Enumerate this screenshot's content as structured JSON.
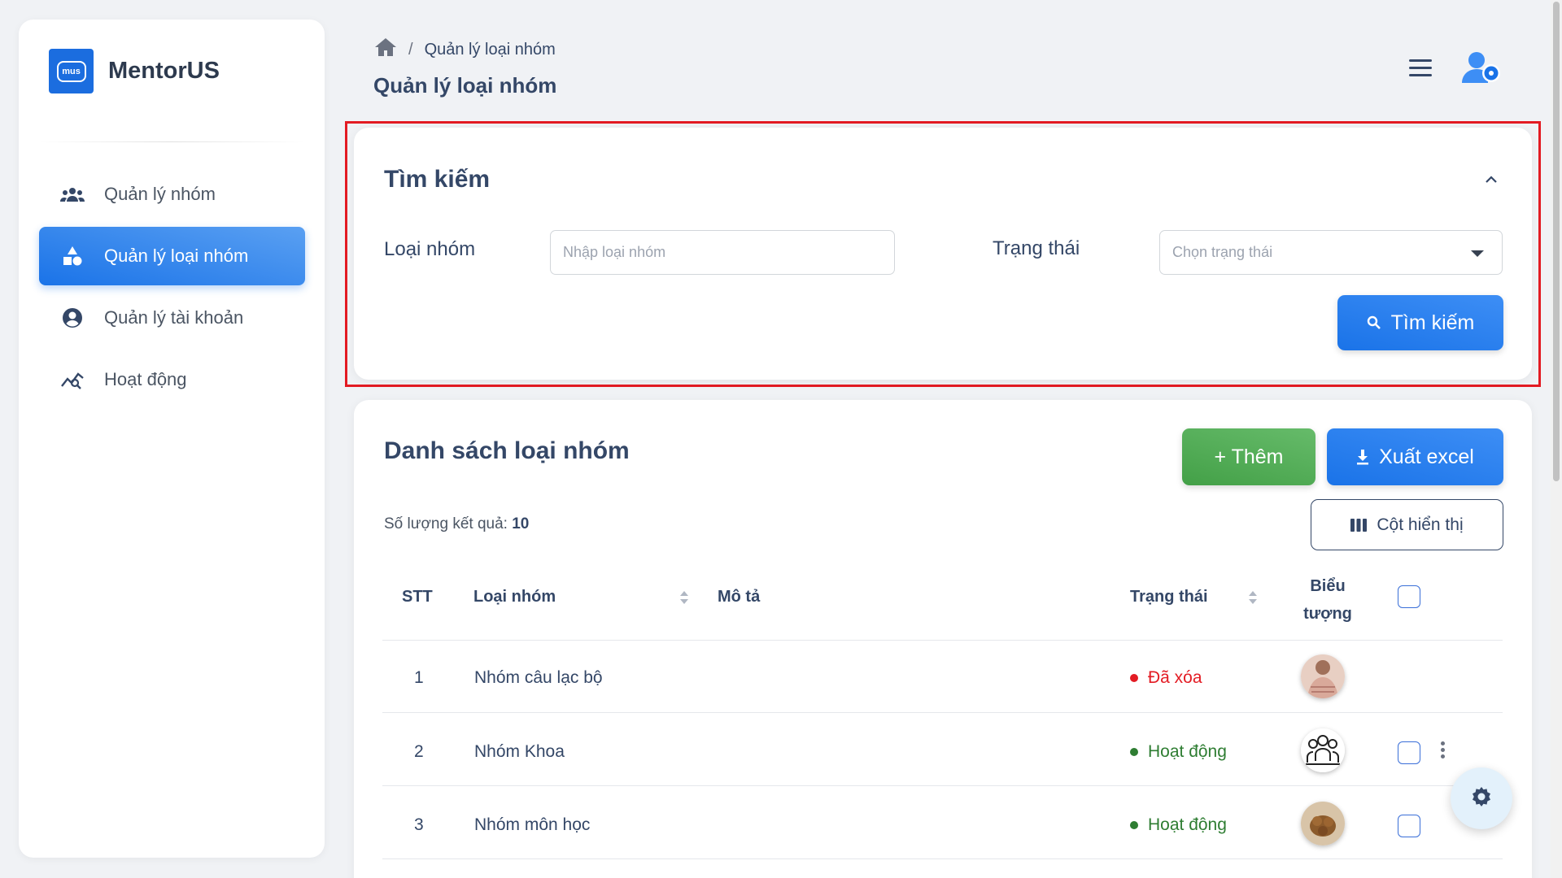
{
  "app": {
    "name": "MentorUS",
    "logo_text": "mus"
  },
  "sidebar": {
    "items": [
      {
        "label": "Quản lý nhóm",
        "icon": "groups-icon",
        "active": false
      },
      {
        "label": "Quản lý loại nhóm",
        "icon": "category-icon",
        "active": true
      },
      {
        "label": "Quản lý tài khoản",
        "icon": "account-circle-icon",
        "active": false
      },
      {
        "label": "Hoạt động",
        "icon": "query-stats-icon",
        "active": false
      }
    ]
  },
  "header": {
    "breadcrumb_current": "Quản lý loại nhóm",
    "breadcrumb_separator": "/",
    "title": "Quản lý loại nhóm"
  },
  "search": {
    "title": "Tìm kiếm",
    "group_type_label": "Loại nhóm",
    "group_type_placeholder": "Nhập loại nhóm",
    "status_label": "Trạng thái",
    "status_placeholder": "Chọn trạng thái",
    "search_button": "Tìm kiếm"
  },
  "list": {
    "title": "Danh sách loại nhóm",
    "add_button": "+ Thêm",
    "export_button": "Xuất excel",
    "columns_button": "Cột hiển thị",
    "count_label": "Số lượng kết quả: ",
    "count_value": "10",
    "columns": {
      "stt": "STT",
      "group_type": "Loại nhóm",
      "description": "Mô tả",
      "status": "Trạng thái",
      "icon_line1": "Biểu",
      "icon_line2": "tượng"
    },
    "rows": [
      {
        "stt": "1",
        "name": "Nhóm câu lạc bộ",
        "description": "",
        "status": "Đã xóa",
        "status_color": "#e31b23"
      },
      {
        "stt": "2",
        "name": "Nhóm Khoa",
        "description": "",
        "status": "Hoạt động",
        "status_color": "#2e7d32"
      },
      {
        "stt": "3",
        "name": "Nhóm môn học",
        "description": "",
        "status": "Hoạt động",
        "status_color": "#2e7d32"
      }
    ]
  },
  "colors": {
    "primary": "#1a73e8",
    "success": "#43a047",
    "danger": "#e31b23",
    "highlight_border": "#e31b23"
  }
}
